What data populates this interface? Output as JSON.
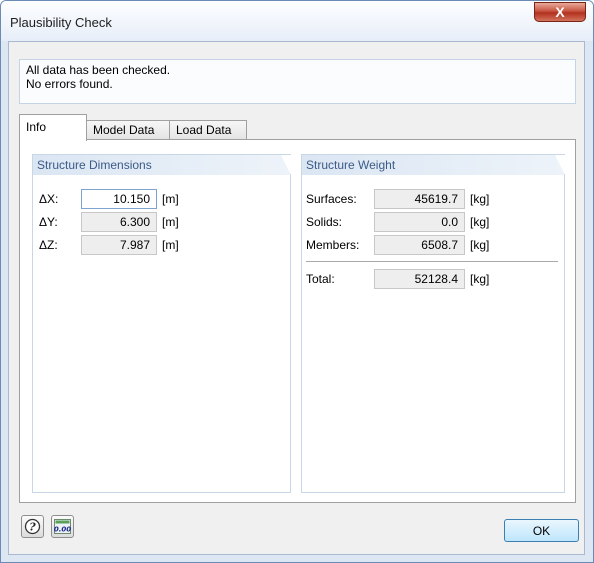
{
  "window": {
    "title": "Plausibility Check",
    "close_glyph": "X"
  },
  "message": {
    "line1": "All data has been checked.",
    "line2": "No errors found."
  },
  "tabs": [
    {
      "label": "Info",
      "active": true
    },
    {
      "label": "Model Data",
      "active": false
    },
    {
      "label": "Load Data",
      "active": false
    }
  ],
  "dimensions": {
    "header": "Structure Dimensions",
    "rows": [
      {
        "label": "ΔX:",
        "value": "10.150",
        "unit": "[m]"
      },
      {
        "label": "ΔY:",
        "value": "6.300",
        "unit": "[m]"
      },
      {
        "label": "ΔZ:",
        "value": "7.987",
        "unit": "[m]"
      }
    ]
  },
  "weight": {
    "header": "Structure Weight",
    "rows": [
      {
        "label": "Surfaces:",
        "value": "45619.7",
        "unit": "[kg]"
      },
      {
        "label": "Solids:",
        "value": "0.0",
        "unit": "[kg]"
      },
      {
        "label": "Members:",
        "value": "6508.7",
        "unit": "[kg]"
      }
    ],
    "total": {
      "label": "Total:",
      "value": "52128.4",
      "unit": "[kg]"
    }
  },
  "footer": {
    "help_icon": "help-icon",
    "units_icon": "decimal-places-icon",
    "units_text": "0.00",
    "ok_label": "OK"
  },
  "colors": {
    "group_header_text": "#3b5b87",
    "ok_button": "#bee6fd",
    "close_button": "#c75441"
  }
}
